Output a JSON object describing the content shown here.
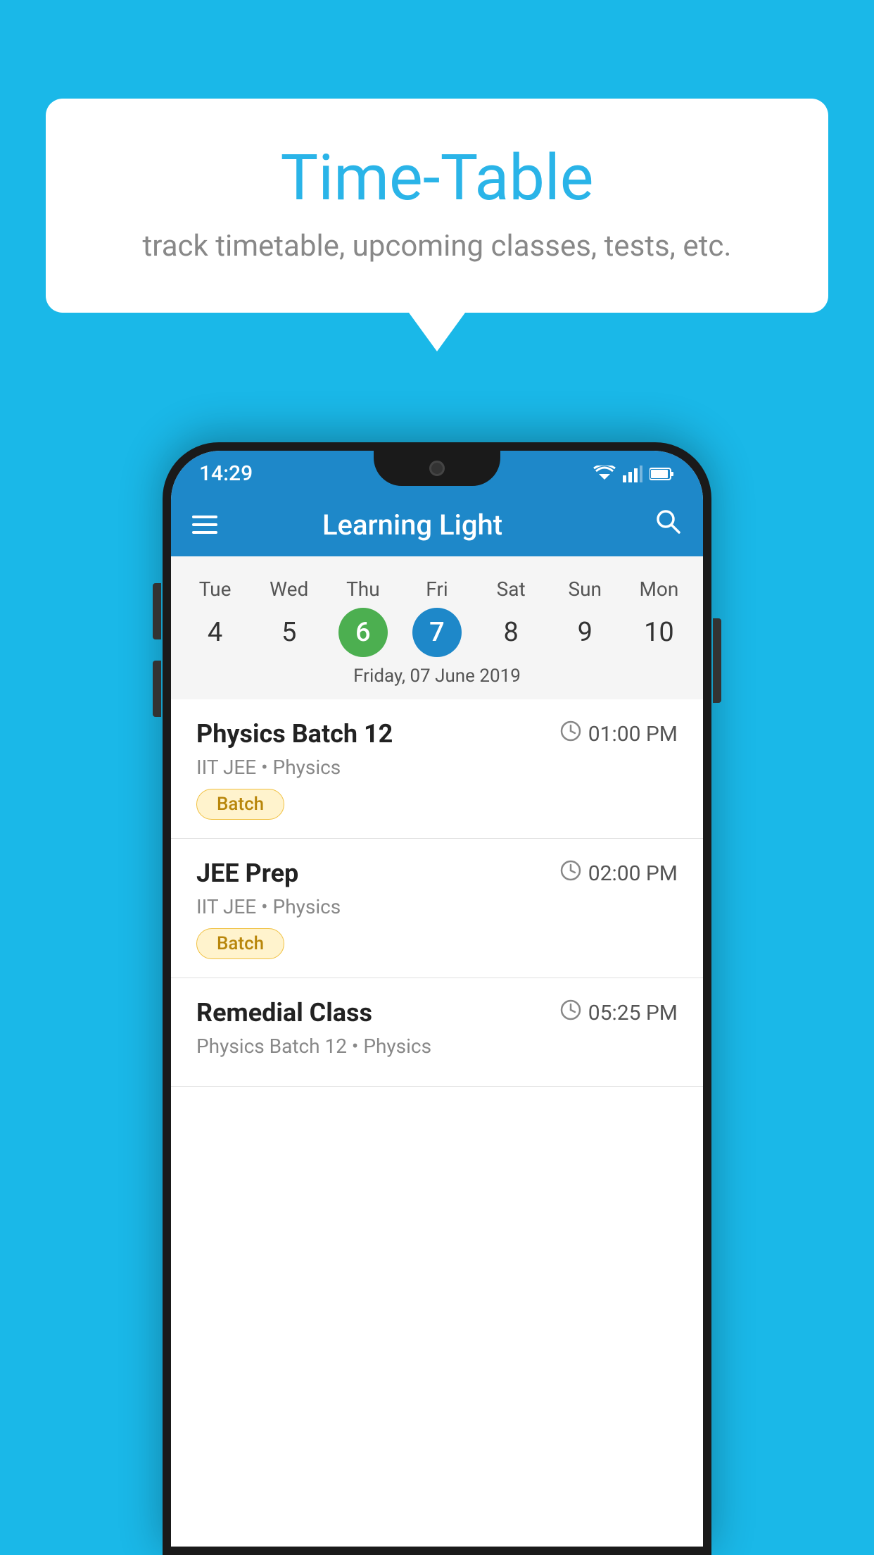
{
  "background_color": "#1ab8e8",
  "speech_bubble": {
    "title": "Time-Table",
    "subtitle": "track timetable, upcoming classes, tests, etc."
  },
  "status_bar": {
    "time": "14:29"
  },
  "app_bar": {
    "title": "Learning Light"
  },
  "calendar": {
    "days": [
      "Tue",
      "Wed",
      "Thu",
      "Fri",
      "Sat",
      "Sun",
      "Mon"
    ],
    "dates": [
      "4",
      "5",
      "6",
      "7",
      "8",
      "9",
      "10"
    ],
    "today_index": 2,
    "selected_index": 3,
    "selected_label": "Friday, 07 June 2019"
  },
  "schedule": {
    "items": [
      {
        "title": "Physics Batch 12",
        "time": "01:00 PM",
        "subtitle": "IIT JEE • Physics",
        "badge": "Batch"
      },
      {
        "title": "JEE Prep",
        "time": "02:00 PM",
        "subtitle": "IIT JEE • Physics",
        "badge": "Batch"
      },
      {
        "title": "Remedial Class",
        "time": "05:25 PM",
        "subtitle": "Physics Batch 12 • Physics",
        "badge": null
      }
    ]
  }
}
